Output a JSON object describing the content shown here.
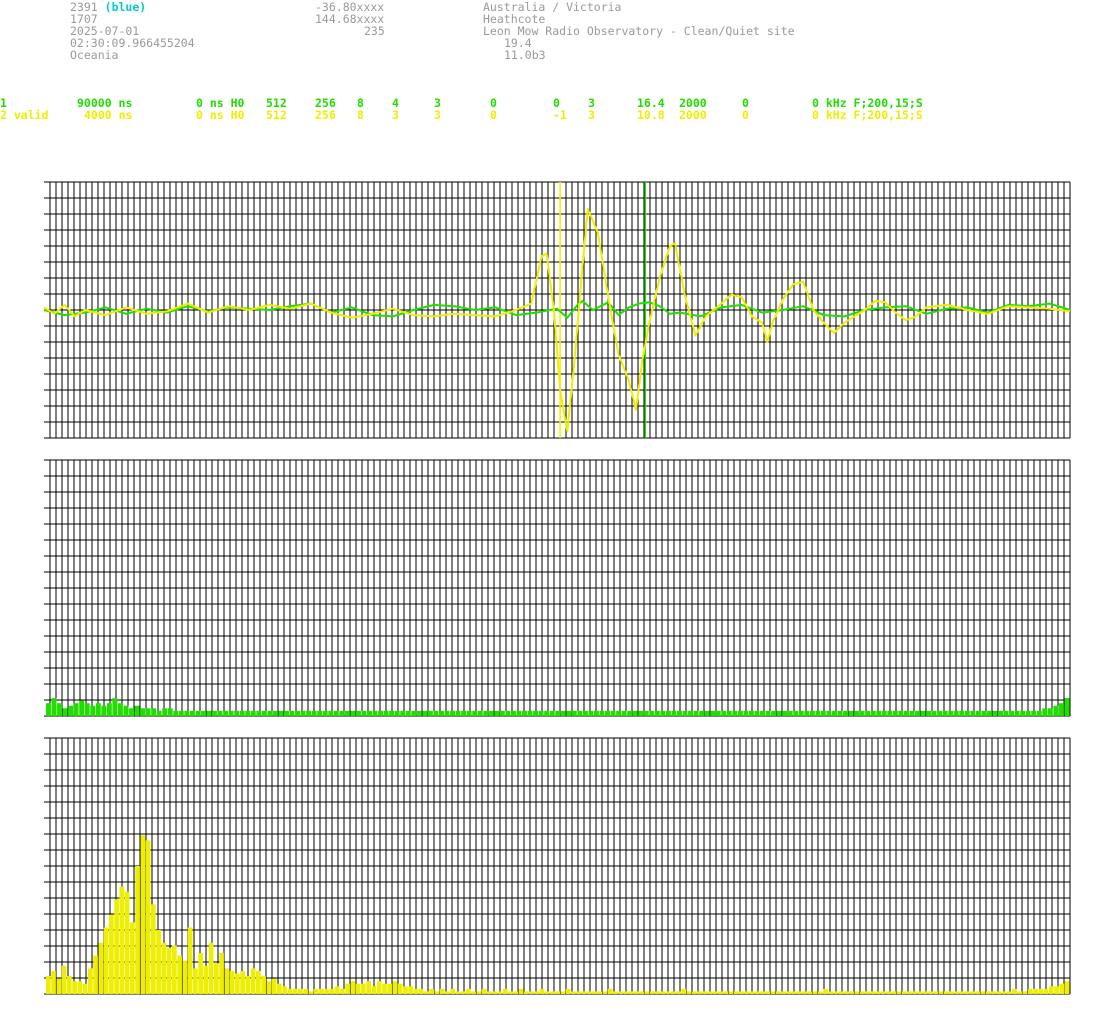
{
  "header": {
    "col1": {
      "id": "2391",
      "id_note": "(blue)",
      "line2": "1707",
      "date": "2025-07-01",
      "time": "02:30:09.966455204",
      "region": "Oceania"
    },
    "col2": {
      "lat": "-36.80xxxx",
      "lon": "144.68xxxx",
      "alt": "235"
    },
    "col3": {
      "location": "Australia / Victoria",
      "town": "Heathcote",
      "site": "Leon Mow Radio Observatory - Clean/Quiet site",
      "v1": "19.4",
      "v2": "11.0b3"
    },
    "colors": {
      "gray": "#9a9a9a",
      "blue_note": "#00cccc"
    }
  },
  "channels": [
    {
      "c1": "1",
      "c2": "90000 ns",
      "c3": "0 ns H0",
      "c4": "512",
      "c5": "256",
      "c6": "8",
      "c7": "4",
      "c8": "3",
      "c9": "0",
      "c10": "0",
      "c11": "3",
      "c12": "16.4",
      "c13": "2000",
      "c14": "0",
      "c15": "0 kHz F;200,15;S",
      "color": "#22dd00"
    },
    {
      "c1": "2 valid",
      "c2": "4000 ns",
      "c3": "0 ns H0",
      "c4": "512",
      "c5": "256",
      "c6": "8",
      "c7": "3",
      "c8": "3",
      "c9": "0",
      "c10": "-1",
      "c11": "3",
      "c12": "10.8",
      "c13": "2000",
      "c14": "0",
      "c15": "0 kHz F;200,15;S",
      "color": "#eeee00"
    }
  ],
  "chart_data": [
    {
      "type": "line",
      "panel": "waveform",
      "xlim": [
        0,
        100
      ],
      "ylim": [
        -1,
        1
      ],
      "grid": true,
      "cursor_lines": [
        {
          "x": 50.3,
          "color": "#eeee00"
        },
        {
          "x": 58.6,
          "color": "#22dd00"
        }
      ],
      "series": [
        {
          "color": "#22dd00",
          "points": [
            [
              0,
              0.0
            ],
            [
              2,
              -0.04
            ],
            [
              4,
              -0.02
            ],
            [
              6,
              0.02
            ],
            [
              8,
              -0.03
            ],
            [
              10,
              0.01
            ],
            [
              12,
              -0.02
            ],
            [
              14,
              0.03
            ],
            [
              16,
              -0.01
            ],
            [
              18,
              0.02
            ],
            [
              20,
              0.01
            ],
            [
              22,
              0.0
            ],
            [
              24,
              0.03
            ],
            [
              26,
              0.05
            ],
            [
              28,
              -0.02
            ],
            [
              30,
              0.02
            ],
            [
              32,
              -0.04
            ],
            [
              34,
              -0.05
            ],
            [
              36,
              0.0
            ],
            [
              38,
              0.04
            ],
            [
              40,
              0.03
            ],
            [
              42,
              0.0
            ],
            [
              44,
              0.02
            ],
            [
              46,
              -0.04
            ],
            [
              48,
              -0.02
            ],
            [
              50,
              0.01
            ],
            [
              51,
              -0.06
            ],
            [
              52,
              0.04
            ],
            [
              52.5,
              0.07
            ],
            [
              53.5,
              0.0
            ],
            [
              55,
              0.06
            ],
            [
              56,
              -0.04
            ],
            [
              57,
              0.02
            ],
            [
              58,
              0.05
            ],
            [
              59,
              0.06
            ],
            [
              60,
              0.03
            ],
            [
              61,
              -0.03
            ],
            [
              62,
              -0.02
            ],
            [
              64,
              -0.05
            ],
            [
              66,
              0.02
            ],
            [
              68,
              0.04
            ],
            [
              70,
              -0.02
            ],
            [
              72,
              0.0
            ],
            [
              74,
              0.03
            ],
            [
              76,
              -0.04
            ],
            [
              78,
              -0.05
            ],
            [
              80,
              0.0
            ],
            [
              82,
              0.02
            ],
            [
              84,
              0.03
            ],
            [
              86,
              -0.03
            ],
            [
              88,
              0.01
            ],
            [
              90,
              0.02
            ],
            [
              92,
              -0.02
            ],
            [
              94,
              0.04
            ],
            [
              96,
              0.03
            ],
            [
              98,
              0.05
            ],
            [
              100,
              0.0
            ]
          ]
        },
        {
          "color": "#eeee00",
          "points": [
            [
              0,
              0.02
            ],
            [
              1,
              -0.03
            ],
            [
              2,
              0.04
            ],
            [
              3,
              -0.05
            ],
            [
              4,
              0.0
            ],
            [
              6,
              -0.04
            ],
            [
              8,
              0.02
            ],
            [
              10,
              -0.03
            ],
            [
              12,
              -0.01
            ],
            [
              14,
              0.05
            ],
            [
              16,
              -0.02
            ],
            [
              18,
              0.03
            ],
            [
              20,
              0.0
            ],
            [
              22,
              0.04
            ],
            [
              24,
              0.01
            ],
            [
              26,
              0.05
            ],
            [
              28,
              -0.02
            ],
            [
              30,
              -0.06
            ],
            [
              32,
              -0.03
            ],
            [
              34,
              0.01
            ],
            [
              36,
              -0.04
            ],
            [
              38,
              -0.05
            ],
            [
              40,
              -0.03
            ],
            [
              42,
              -0.04
            ],
            [
              44,
              -0.05
            ],
            [
              46,
              0.0
            ],
            [
              47.5,
              0.05
            ],
            [
              48.5,
              0.42
            ],
            [
              49,
              0.44
            ],
            [
              49.7,
              0.0
            ],
            [
              50.3,
              -0.62
            ],
            [
              51,
              -0.95
            ],
            [
              51.7,
              -0.4
            ],
            [
              52.5,
              0.35
            ],
            [
              53,
              0.79
            ],
            [
              54,
              0.6
            ],
            [
              55,
              0.1
            ],
            [
              56,
              -0.35
            ],
            [
              57,
              -0.55
            ],
            [
              57.7,
              -0.78
            ],
            [
              58.3,
              -0.4
            ],
            [
              59,
              -0.1
            ],
            [
              60,
              0.25
            ],
            [
              61,
              0.5
            ],
            [
              61.5,
              0.52
            ],
            [
              62.5,
              0.1
            ],
            [
              63.5,
              -0.2
            ],
            [
              64.5,
              -0.05
            ],
            [
              66,
              0.05
            ],
            [
              67,
              0.12
            ],
            [
              68,
              0.1
            ],
            [
              69,
              -0.05
            ],
            [
              70,
              -0.1
            ],
            [
              70.5,
              -0.25
            ],
            [
              71,
              -0.1
            ],
            [
              72,
              0.08
            ],
            [
              73,
              0.2
            ],
            [
              74,
              0.22
            ],
            [
              75,
              0.0
            ],
            [
              76,
              -0.1
            ],
            [
              77,
              -0.18
            ],
            [
              78,
              -0.1
            ],
            [
              79,
              -0.05
            ],
            [
              80,
              0.0
            ],
            [
              81,
              0.07
            ],
            [
              82,
              0.06
            ],
            [
              83,
              -0.02
            ],
            [
              84,
              -0.08
            ],
            [
              85,
              -0.05
            ],
            [
              86,
              0.02
            ],
            [
              88,
              0.04
            ],
            [
              90,
              0.0
            ],
            [
              92,
              -0.03
            ],
            [
              94,
              0.03
            ],
            [
              96,
              0.02
            ],
            [
              98,
              0.01
            ],
            [
              100,
              -0.01
            ]
          ]
        }
      ]
    },
    {
      "type": "bar",
      "panel": "spectrum-1",
      "color": "#22dd00",
      "ylim": [
        0,
        1
      ],
      "grid": true,
      "values": [
        0.05,
        0.07,
        0.05,
        0.03,
        0.04,
        0.05,
        0.06,
        0.05,
        0.04,
        0.05,
        0.04,
        0.05,
        0.07,
        0.05,
        0.04,
        0.03,
        0.04,
        0.03,
        0.03,
        0.03,
        0.02,
        0.03,
        0.03,
        0.02,
        0.02,
        0.02,
        0.02,
        0.02,
        0.02,
        0.02,
        0.02,
        0.02,
        0.02,
        0.02,
        0.02,
        0.02,
        0.02,
        0.02,
        0.02,
        0.02,
        0.02,
        0.02,
        0.02,
        0.02,
        0.02,
        0.02,
        0.02,
        0.02,
        0.02,
        0.02,
        0.02,
        0.02,
        0.02,
        0.02,
        0.02,
        0.02,
        0.02,
        0.02,
        0.02,
        0.02,
        0.02,
        0.02,
        0.02,
        0.02,
        0.02,
        0.02,
        0.02,
        0.02,
        0.02,
        0.02,
        0.02,
        0.02,
        0.02,
        0.02,
        0.02,
        0.02,
        0.02,
        0.02,
        0.02,
        0.02,
        0.02,
        0.02,
        0.02,
        0.02,
        0.02,
        0.02,
        0.02,
        0.02,
        0.02,
        0.02,
        0.02,
        0.02,
        0.02,
        0.02,
        0.02,
        0.02,
        0.02,
        0.02,
        0.02,
        0.02,
        0.02,
        0.02,
        0.02,
        0.02,
        0.02,
        0.02,
        0.02,
        0.02,
        0.02,
        0.02,
        0.02,
        0.02,
        0.02,
        0.02,
        0.02,
        0.02,
        0.02,
        0.02,
        0.02,
        0.02,
        0.02,
        0.02,
        0.02,
        0.02,
        0.02,
        0.02,
        0.02,
        0.02,
        0.02,
        0.02,
        0.02,
        0.02,
        0.02,
        0.02,
        0.02,
        0.02,
        0.02,
        0.02,
        0.02,
        0.02,
        0.02,
        0.02,
        0.02,
        0.02,
        0.02,
        0.02,
        0.02,
        0.02,
        0.02,
        0.02,
        0.02,
        0.02,
        0.02,
        0.02,
        0.02,
        0.02,
        0.02,
        0.02,
        0.02,
        0.02,
        0.02,
        0.02,
        0.02,
        0.02,
        0.02,
        0.02,
        0.02,
        0.02,
        0.02,
        0.02,
        0.02,
        0.02,
        0.02,
        0.02,
        0.02,
        0.02,
        0.02,
        0.02,
        0.02,
        0.02,
        0.03,
        0.03,
        0.04,
        0.05,
        0.07
      ]
    },
    {
      "type": "bar",
      "panel": "spectrum-2",
      "color": "#eeee00",
      "ylim": [
        0,
        1
      ],
      "grid": true,
      "values": [
        0.07,
        0.09,
        0.06,
        0.11,
        0.07,
        0.05,
        0.05,
        0.04,
        0.1,
        0.15,
        0.2,
        0.26,
        0.31,
        0.37,
        0.42,
        0.4,
        0.28,
        0.5,
        0.62,
        0.6,
        0.35,
        0.25,
        0.2,
        0.18,
        0.19,
        0.15,
        0.13,
        0.26,
        0.1,
        0.16,
        0.11,
        0.2,
        0.12,
        0.16,
        0.1,
        0.09,
        0.08,
        0.09,
        0.07,
        0.1,
        0.09,
        0.07,
        0.05,
        0.06,
        0.04,
        0.03,
        0.02,
        0.02,
        0.02,
        0.02,
        0.01,
        0.02,
        0.02,
        0.02,
        0.02,
        0.03,
        0.02,
        0.04,
        0.05,
        0.04,
        0.04,
        0.05,
        0.03,
        0.05,
        0.04,
        0.04,
        0.05,
        0.04,
        0.03,
        0.03,
        0.02,
        0.02,
        0.01,
        0.02,
        0.01,
        0.02,
        0.01,
        0.02,
        0.01,
        0.01,
        0.02,
        0.01,
        0.01,
        0.02,
        0.01,
        0.01,
        0.01,
        0.02,
        0.01,
        0.01,
        0.02,
        0.01,
        0.01,
        0.01,
        0.02,
        0.01,
        0.01,
        0.01,
        0.01,
        0.02,
        0.01,
        0.01,
        0.01,
        0.01,
        0.01,
        0.01,
        0.01,
        0.02,
        0.01,
        0.01,
        0.01,
        0.01,
        0.01,
        0.01,
        0.01,
        0.01,
        0.01,
        0.01,
        0.01,
        0.01,
        0.01,
        0.02,
        0.01,
        0.01,
        0.01,
        0.01,
        0.01,
        0.01,
        0.01,
        0.01,
        0.01,
        0.01,
        0.01,
        0.01,
        0.01,
        0.01,
        0.01,
        0.01,
        0.01,
        0.01,
        0.01,
        0.01,
        0.01,
        0.01,
        0.01,
        0.01,
        0.01,
        0.01,
        0.02,
        0.01,
        0.01,
        0.01,
        0.01,
        0.01,
        0.01,
        0.01,
        0.01,
        0.01,
        0.01,
        0.01,
        0.01,
        0.01,
        0.01,
        0.01,
        0.01,
        0.01,
        0.01,
        0.01,
        0.01,
        0.01,
        0.01,
        0.01,
        0.01,
        0.01,
        0.01,
        0.01,
        0.01,
        0.01,
        0.01,
        0.01,
        0.01,
        0.01,
        0.01,
        0.01,
        0.02,
        0.01,
        0.01,
        0.02,
        0.02,
        0.02,
        0.02,
        0.03,
        0.03,
        0.04,
        0.05
      ]
    }
  ]
}
